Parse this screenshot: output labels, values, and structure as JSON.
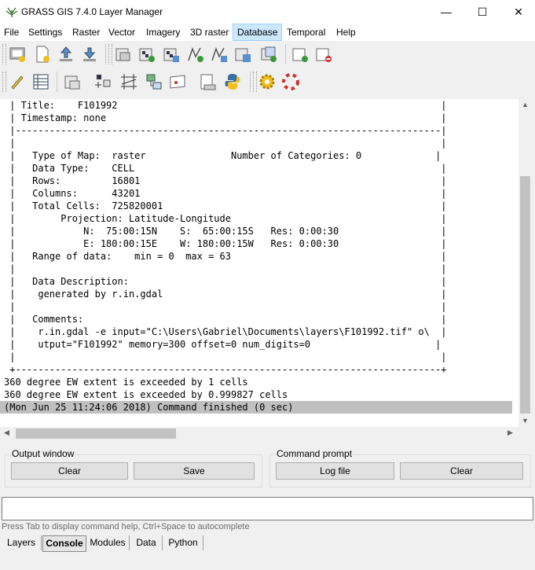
{
  "window": {
    "title": "GRASS GIS 7.4.0 Layer Manager",
    "minimize": "—",
    "maximize": "☐",
    "close": "✕"
  },
  "menu": [
    "File",
    "Settings",
    "Raster",
    "Vector",
    "Imagery",
    "3D raster",
    "Database",
    "Temporal",
    "Help"
  ],
  "menu_active": "Database",
  "toolbar1_icons": [
    "new-workspace-icon",
    "open-workspace-icon",
    "load-map-icon",
    "save-workspace-icon",
    "add-raster-icon",
    "add-multiple-raster-icon",
    "add-rgb-icon",
    "add-vector-icon",
    "add-multiple-vector-icon",
    "add-misc-icon",
    "add-overlay-icon",
    "add-group-icon",
    "remove-layer-icon"
  ],
  "toolbar2_icons": [
    "edit-vector-icon",
    "attribute-table-icon",
    "map-display-icon",
    "georectify-icon",
    "gcp-icon",
    "modeler-icon",
    "map-composer-icon",
    "script-icon",
    "python-icon",
    "settings-icon",
    "help-icon"
  ],
  "console_lines": [
    " | Title:    F101992                                                         |",
    " | Timestamp: none                                                           |",
    " |---------------------------------------------------------------------------|",
    " |                                                                           |",
    " |   Type of Map:  raster               Number of Categories: 0             |",
    " |   Data Type:    CELL                                                      |",
    " |   Rows:         16801                                                     |",
    " |   Columns:      43201                                                     |",
    " |   Total Cells:  725820001                                                 |",
    " |        Projection: Latitude-Longitude                                     |",
    " |            N:  75:00:15N    S:  65:00:15S   Res: 0:00:30                  |",
    " |            E: 180:00:15E    W: 180:00:15W   Res: 0:00:30                  |",
    " |   Range of data:    min = 0  max = 63                                     |",
    " |                                                                           |",
    " |   Data Description:                                                       |",
    " |    generated by r.in.gdal                                                 |",
    " |                                                                           |",
    " |   Comments:                                                               |",
    " |    r.in.gdal -e input=\"C:\\Users\\Gabriel\\Documents\\layers\\F101992.tif\" o\\  |",
    " |    utput=\"F101992\" memory=300 offset=0 num_digits=0                      |",
    " |                                                                           |",
    " +---------------------------------------------------------------------------+",
    "360 degree EW extent is exceeded by 1 cells",
    "360 degree EW extent is exceeded by 0.999827 cells"
  ],
  "console_finished": "(Mon Jun 25 11:24:06 2018) Command finished (0 sec)",
  "output_window": {
    "label": "Output window",
    "clear": "Clear",
    "save": "Save"
  },
  "command_prompt": {
    "label": "Command prompt",
    "log_file": "Log file",
    "clear": "Clear"
  },
  "cmd_input": {
    "value": "",
    "hint": "Press Tab to display command help, Ctrl+Space to autocomplete"
  },
  "tabs": [
    "Layers",
    "Console",
    "Modules",
    "Data",
    "Python"
  ],
  "active_tab": "Console"
}
